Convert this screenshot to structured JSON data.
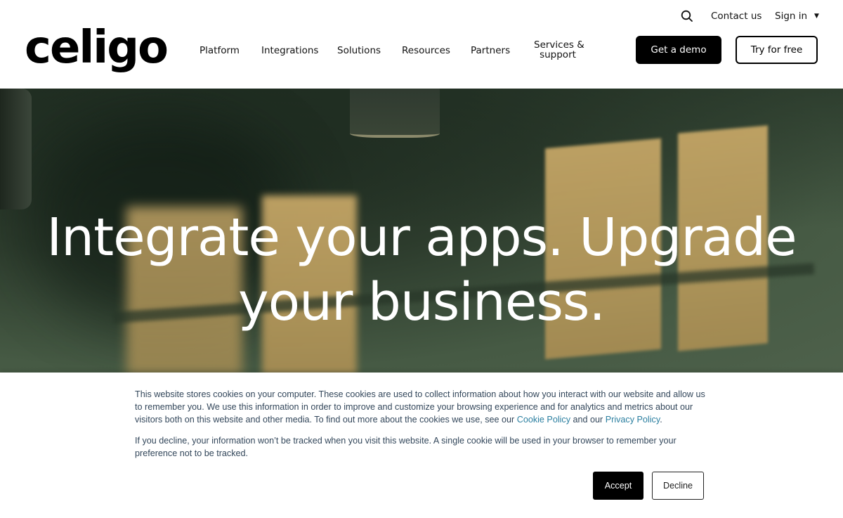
{
  "header": {
    "logo_text": "celigo",
    "nav": [
      {
        "label": "Platform"
      },
      {
        "label": "Integrations"
      },
      {
        "label": "Solutions"
      },
      {
        "label": "Resources"
      },
      {
        "label": "Partners"
      },
      {
        "label_line1": "Services &",
        "label_line2": "support"
      }
    ],
    "utility": {
      "search_icon": "search-icon",
      "contact_label": "Contact us",
      "signin_label": "Sign in",
      "signin_caret": "▼"
    },
    "cta": {
      "demo_label": "Get a demo",
      "try_label": "Try for free"
    }
  },
  "hero": {
    "title_line1": "Integrate your apps. Upgrade",
    "title_line2": "your business."
  },
  "cookie_banner": {
    "p1_before": "This website stores cookies on your computer. These cookies are used to collect information about how you interact with our website and allow us to remember you. We use this information in order to improve and customize your browsing experience and for analytics and metrics about our visitors both on this website and other media. To find out more about the cookies we use, see our ",
    "cookie_policy_link": "Cookie Policy",
    "p1_middle": " and our ",
    "privacy_policy_link": "Privacy Policy",
    "p1_after": ".",
    "p2": "If you decline, your information won’t be tracked when you visit this website. A single cookie will be used in your browser to remember your preference not to be tracked.",
    "accept_label": "Accept",
    "decline_label": "Decline",
    "link_color": "#2b7fa0"
  }
}
